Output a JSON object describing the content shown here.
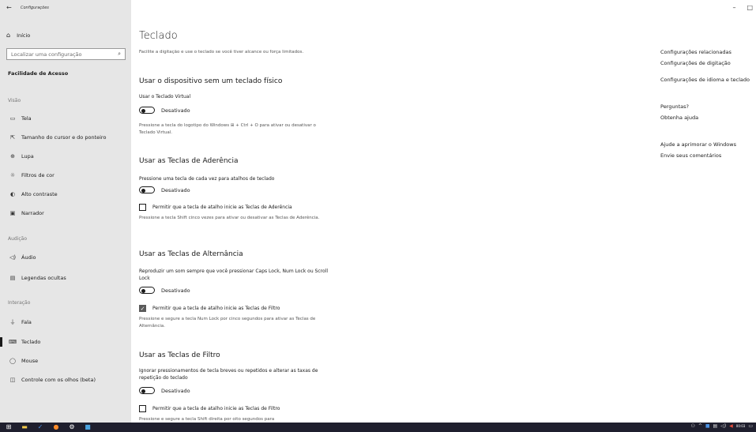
{
  "window": {
    "app_title": "Configurações",
    "minimize": "–",
    "maximize": "□"
  },
  "sidebar": {
    "home_label": "Início",
    "search_placeholder": "Localizar uma configuração",
    "category_title": "Facilidade de Acesso",
    "sections": {
      "vision": "Visão",
      "hearing": "Audição",
      "interaction": "Interação"
    },
    "items": [
      {
        "label": "Tela",
        "icon": "monitor-icon"
      },
      {
        "label": "Tamanho do cursor e do ponteiro",
        "icon": "cursor-icon"
      },
      {
        "label": "Lupa",
        "icon": "magnifier-icon"
      },
      {
        "label": "Filtros de cor",
        "icon": "sun-icon"
      },
      {
        "label": "Alto contraste",
        "icon": "contrast-icon"
      },
      {
        "label": "Narrador",
        "icon": "narrator-icon"
      },
      {
        "label": "Áudio",
        "icon": "speaker-icon"
      },
      {
        "label": "Legendas ocultas",
        "icon": "captions-icon"
      },
      {
        "label": "Fala",
        "icon": "microphone-icon"
      },
      {
        "label": "Teclado",
        "icon": "keyboard-icon"
      },
      {
        "label": "Mouse",
        "icon": "mouse-icon"
      },
      {
        "label": "Controle com os olhos (beta)",
        "icon": "eye-control-icon"
      }
    ],
    "active_item": "Teclado"
  },
  "main": {
    "title": "Teclado",
    "intro": "Facilite a digitação e use o teclado se você tiver alcance ou força limitados.",
    "sections": [
      {
        "heading": "Usar o dispositivo sem um teclado físico",
        "label": "Usar o Teclado Virtual",
        "toggle_state": "Desativado",
        "desc": "Pressione a tecla do logotipo do Windows ⊞ + Ctrl + O para ativar ou desativar o Teclado Virtual."
      },
      {
        "heading": "Usar as Teclas de Aderência",
        "label": "Pressione uma tecla de cada vez para atalhos de teclado",
        "toggle_state": "Desativado",
        "checkbox_label": "Permitir que a tecla de atalho inicie as Teclas de Aderência",
        "checkbox_checked": false,
        "desc": "Pressione a tecla Shift cinco vezes para ativar ou desativar as Teclas de Aderência."
      },
      {
        "heading": "Usar as Teclas de Alternância",
        "label": "Reproduzir um som sempre que você pressionar Caps Lock, Num Lock ou Scroll Lock",
        "toggle_state": "Desativado",
        "checkbox_label": "Permitir que a tecla de atalho inicie as Teclas de Filtro",
        "checkbox_checked": true,
        "desc": "Pressione e segure a tecla Num Lock por cinco segundos para ativar as Teclas de Alternância."
      },
      {
        "heading": "Usar as Teclas de Filtro",
        "label": "Ignorar pressionamentos de tecla breves ou repetidos e alterar as taxas de repetição do teclado",
        "toggle_state": "Desativado",
        "checkbox_label": "Permitir que a tecla de atalho inicie as Teclas de Filtro",
        "checkbox_checked": false,
        "desc": "Pressione e segure a tecla Shift direita por oito segundos para"
      }
    ]
  },
  "related": {
    "heading": "Configurações relacionadas",
    "link1": "Configurações de digitação",
    "link2": "Configurações de idioma e teclado",
    "questions_heading": "Perguntas?",
    "help_link": "Obtenha ajuda",
    "improve_heading": "Ajude a aprimorar o Windows",
    "feedback_link": "Envie seus comentários"
  },
  "taskbar": {
    "clock_time": "00:03"
  }
}
